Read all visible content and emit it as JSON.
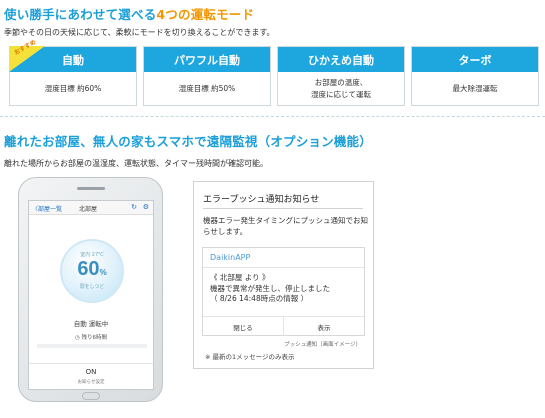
{
  "section1": {
    "title_prefix": "使い勝手にあわせて選べる",
    "title_highlight": "4つの運転モード",
    "description": "季節やその日の天候に応じて、柔軟にモードを切り換えることができます。"
  },
  "modes": [
    {
      "badge": "おすすめ",
      "name": "自動",
      "desc_line1": "湿度目標 約60%",
      "desc_line2": ""
    },
    {
      "badge": "",
      "name": "パワフル自動",
      "desc_line1": "湿度目標 約50%",
      "desc_line2": ""
    },
    {
      "badge": "",
      "name": "ひかえめ自動",
      "desc_line1": "お部屋の温度、",
      "desc_line2": "湿度に応じて運転"
    },
    {
      "badge": "",
      "name": "ターボ",
      "desc_line1": "最大除湿運転",
      "desc_line2": ""
    }
  ],
  "section2": {
    "title": "離れたお部屋、無人の家もスマホで遠隔監視（オプション機能）",
    "description": "離れた場所からお部屋の温湿度、運転状態、タイマー残時間が確認可能。"
  },
  "phone": {
    "back_label": "〈部屋一覧",
    "room_label": "北部屋",
    "refresh_icon": "↻",
    "gear_icon": "⚙",
    "gauge_top": "室内 27℃",
    "humidity_value": "60",
    "humidity_unit": "%",
    "gauge_bottom": "弱をしつど",
    "status": "自動 運転中",
    "timer": "◷ 残り6時間",
    "power": "ON",
    "power_sub": "お知らせ設定"
  },
  "notification": {
    "title": "エラープッシュ通知お知らせ",
    "text": "機器エラー発生タイミングにプッシュ通知でお知らせします。",
    "app_name": "DaikinAPP",
    "message_line1": "《 北部屋 より 》",
    "message_line2": "機器で異常が発生し、停止しました",
    "message_line3": "（ 8/26 14:48時点の情報 ）",
    "close_button": "閉じる",
    "show_button": "表示",
    "caption": "プッシュ通知（画面イメージ）",
    "footnote": "※ 最新の1メッセージのみ表示"
  },
  "colors": {
    "accent_blue": "#1a9fd9",
    "card_header": "#1ea6df",
    "highlight_orange": "#f29600",
    "badge_yellow": "#f4e23a"
  }
}
